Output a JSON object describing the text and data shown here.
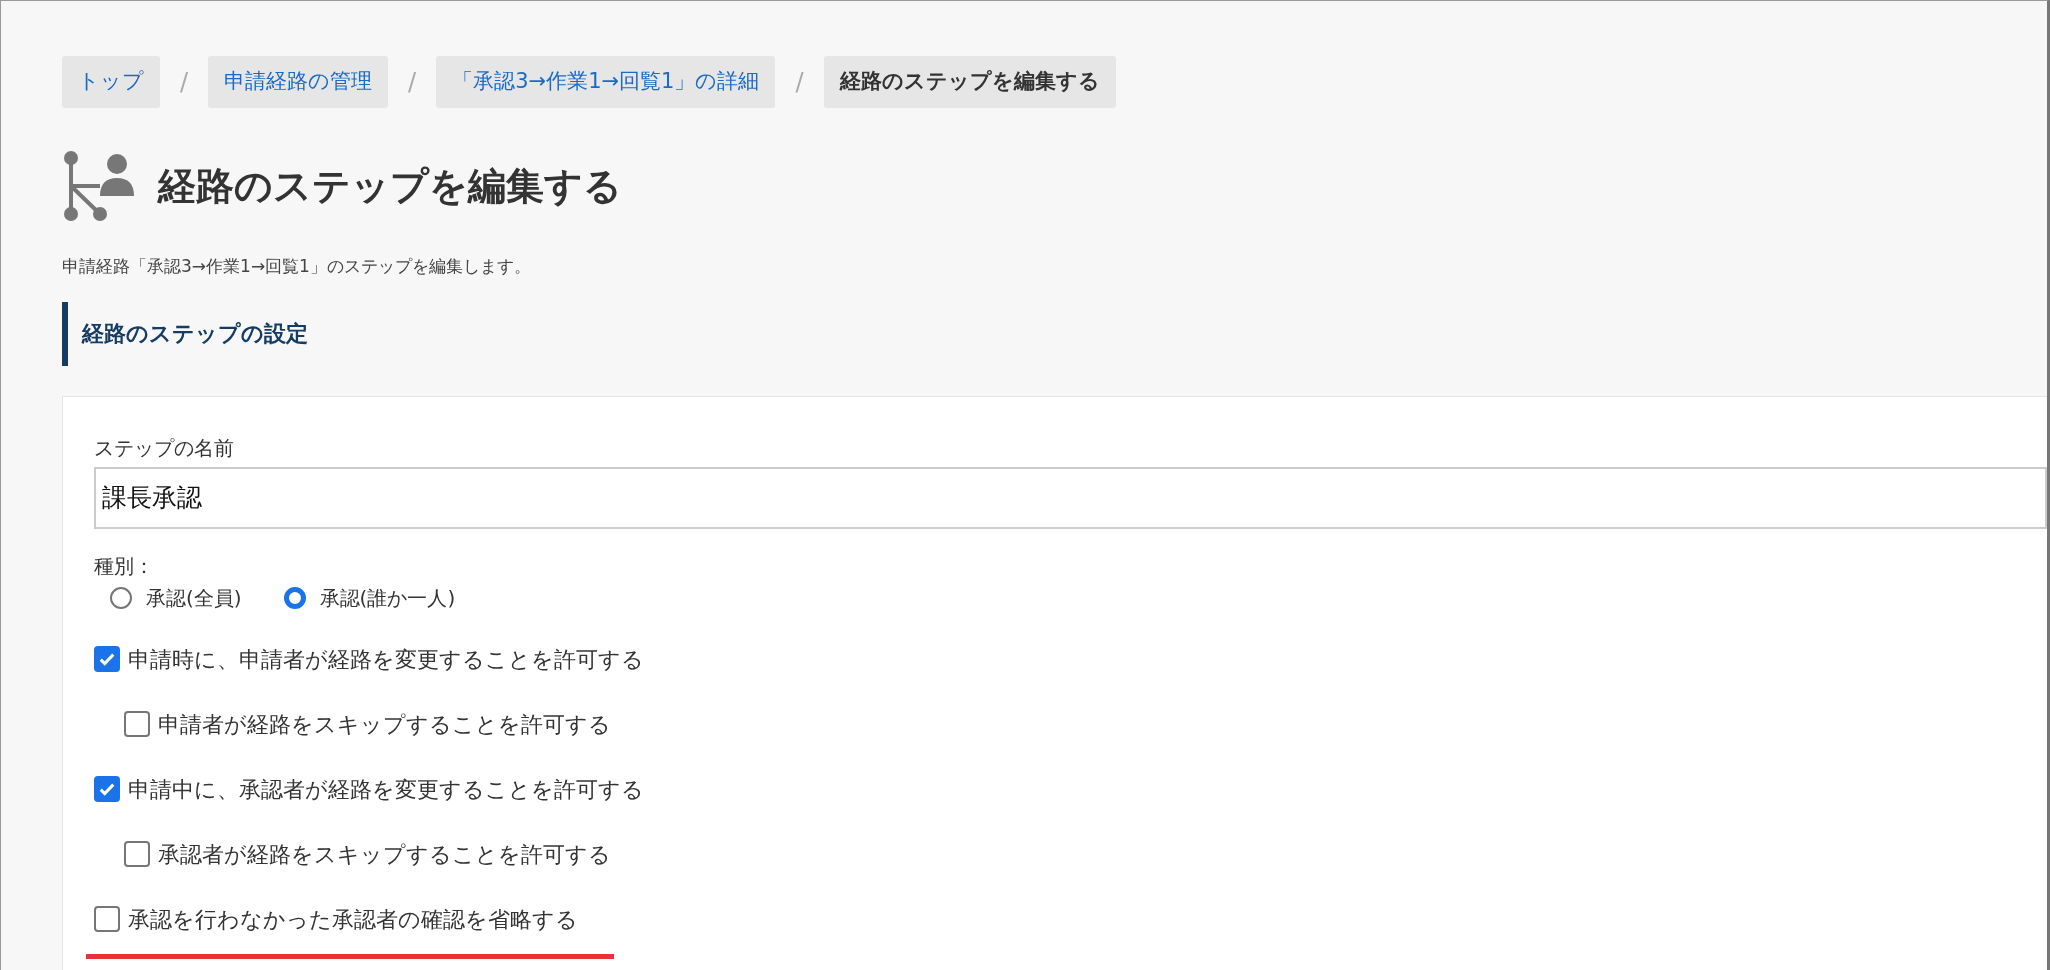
{
  "breadcrumbs": [
    {
      "label": "トップ",
      "current": false
    },
    {
      "separator": "/",
      "label": "申請経路の管理",
      "current": false
    },
    {
      "separator": "/",
      "label": "「承認3→作業1→回覧1」の詳細",
      "current": false
    },
    {
      "separator": "/",
      "label": "経路のステップを編集する",
      "current": true
    }
  ],
  "page_title": "経路のステップを編集する",
  "description": "申請経路「承認3→作業1→回覧1」のステップを編集します。",
  "section_heading": "経路のステップの設定",
  "form": {
    "name_label": "ステップの名前",
    "name_value": "課長承認",
    "type_label": "種別：",
    "type_options": [
      {
        "label": "承認(全員)",
        "selected": false
      },
      {
        "label": "承認(誰か一人)",
        "selected": true
      }
    ],
    "options": [
      {
        "label": "申請時に、申請者が経路を変更することを許可する",
        "checked": true,
        "children": [
          {
            "label": "申請者が経路をスキップすることを許可する",
            "checked": false
          }
        ]
      },
      {
        "label": "申請中に、承認者が経路を変更することを許可する",
        "checked": true,
        "children": [
          {
            "label": "承認者が経路をスキップすることを許可する",
            "checked": false
          }
        ]
      },
      {
        "label": "承認を行わなかった承認者の確認を省略する",
        "checked": false
      }
    ]
  }
}
